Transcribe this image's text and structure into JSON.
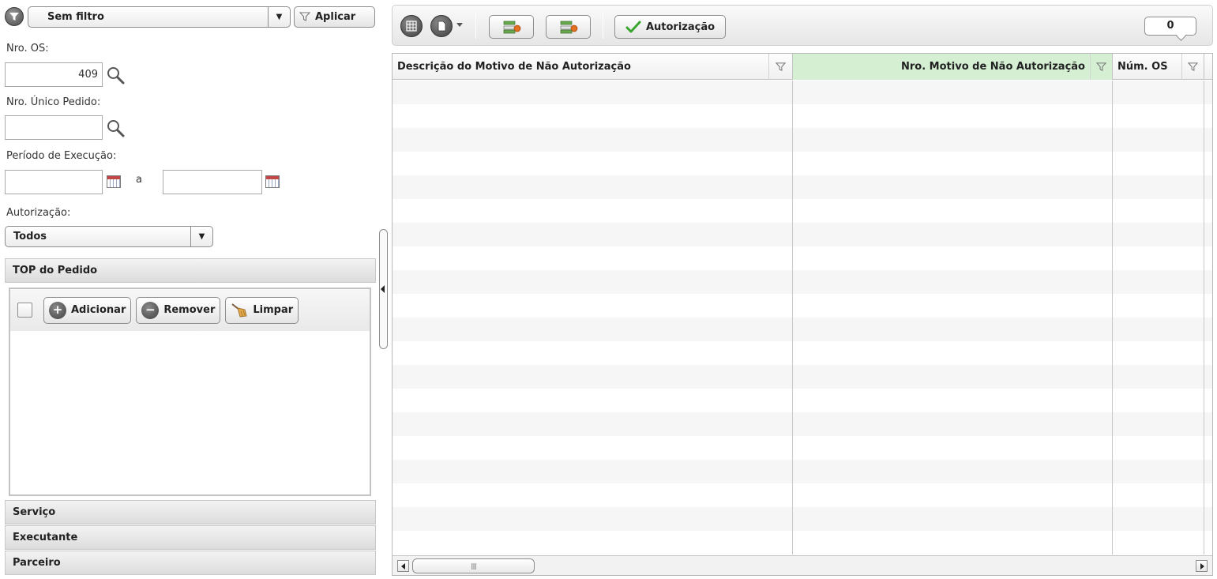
{
  "filter_bar": {
    "saved_filter": "Sem filtro",
    "apply_label": "Aplicar"
  },
  "fields": {
    "nro_os_label": "Nro. OS:",
    "nro_os_value": "409",
    "nro_unico_label": "Nro. Único Pedido:",
    "nro_unico_value": "",
    "periodo_label": "Período de Execução:",
    "periodo_separator": "a",
    "periodo_start": "",
    "periodo_end": "",
    "autorizacao_label": "Autorização:",
    "autorizacao_value": "Todos"
  },
  "sections": {
    "top_pedido": "TOP do Pedido",
    "servico": "Serviço",
    "executante": "Executante",
    "parceiro": "Parceiro"
  },
  "top_toolbar": {
    "add_label": "Adicionar",
    "remove_label": "Remover",
    "clear_label": "Limpar"
  },
  "grid_toolbar": {
    "autorizacao_label": "Autorização",
    "record_count": "0"
  },
  "grid": {
    "columns": [
      "Descrição do Motivo de Não Autorização",
      "Nro. Motivo de Não Autorização",
      "Núm. OS"
    ],
    "sorted_column_color": "#d5efd3"
  },
  "icons": {
    "filter": "filter-funnel-icon",
    "search": "magnifier-icon",
    "calendar": "calendar-icon",
    "plus": "plus-icon",
    "minus": "minus-icon",
    "broom": "broom-icon",
    "check": "green-check-icon"
  }
}
